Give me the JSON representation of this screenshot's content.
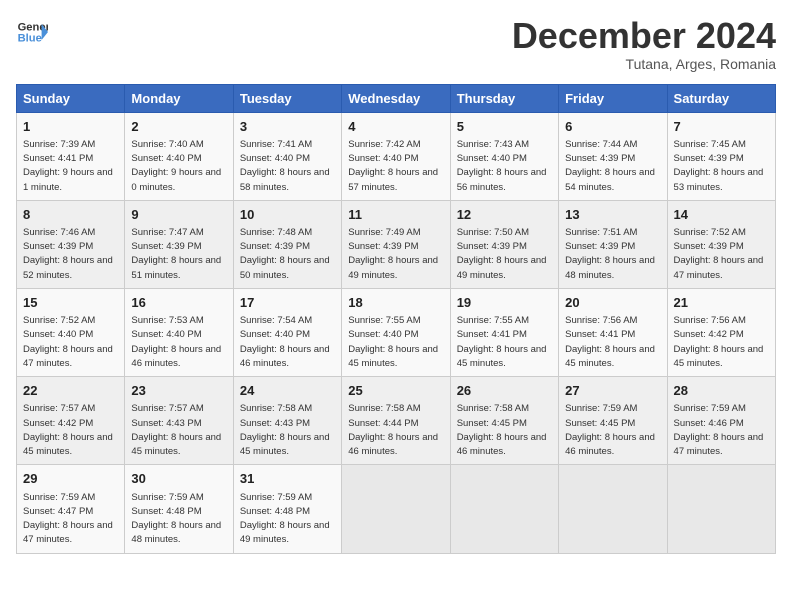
{
  "header": {
    "logo_line1": "General",
    "logo_line2": "Blue",
    "month": "December 2024",
    "location": "Tutana, Arges, Romania"
  },
  "weekdays": [
    "Sunday",
    "Monday",
    "Tuesday",
    "Wednesday",
    "Thursday",
    "Friday",
    "Saturday"
  ],
  "weeks": [
    [
      {
        "day": "1",
        "rise": "Sunrise: 7:39 AM",
        "set": "Sunset: 4:41 PM",
        "daylight": "Daylight: 9 hours and 1 minute."
      },
      {
        "day": "2",
        "rise": "Sunrise: 7:40 AM",
        "set": "Sunset: 4:40 PM",
        "daylight": "Daylight: 9 hours and 0 minutes."
      },
      {
        "day": "3",
        "rise": "Sunrise: 7:41 AM",
        "set": "Sunset: 4:40 PM",
        "daylight": "Daylight: 8 hours and 58 minutes."
      },
      {
        "day": "4",
        "rise": "Sunrise: 7:42 AM",
        "set": "Sunset: 4:40 PM",
        "daylight": "Daylight: 8 hours and 57 minutes."
      },
      {
        "day": "5",
        "rise": "Sunrise: 7:43 AM",
        "set": "Sunset: 4:40 PM",
        "daylight": "Daylight: 8 hours and 56 minutes."
      },
      {
        "day": "6",
        "rise": "Sunrise: 7:44 AM",
        "set": "Sunset: 4:39 PM",
        "daylight": "Daylight: 8 hours and 54 minutes."
      },
      {
        "day": "7",
        "rise": "Sunrise: 7:45 AM",
        "set": "Sunset: 4:39 PM",
        "daylight": "Daylight: 8 hours and 53 minutes."
      }
    ],
    [
      {
        "day": "8",
        "rise": "Sunrise: 7:46 AM",
        "set": "Sunset: 4:39 PM",
        "daylight": "Daylight: 8 hours and 52 minutes."
      },
      {
        "day": "9",
        "rise": "Sunrise: 7:47 AM",
        "set": "Sunset: 4:39 PM",
        "daylight": "Daylight: 8 hours and 51 minutes."
      },
      {
        "day": "10",
        "rise": "Sunrise: 7:48 AM",
        "set": "Sunset: 4:39 PM",
        "daylight": "Daylight: 8 hours and 50 minutes."
      },
      {
        "day": "11",
        "rise": "Sunrise: 7:49 AM",
        "set": "Sunset: 4:39 PM",
        "daylight": "Daylight: 8 hours and 49 minutes."
      },
      {
        "day": "12",
        "rise": "Sunrise: 7:50 AM",
        "set": "Sunset: 4:39 PM",
        "daylight": "Daylight: 8 hours and 49 minutes."
      },
      {
        "day": "13",
        "rise": "Sunrise: 7:51 AM",
        "set": "Sunset: 4:39 PM",
        "daylight": "Daylight: 8 hours and 48 minutes."
      },
      {
        "day": "14",
        "rise": "Sunrise: 7:52 AM",
        "set": "Sunset: 4:39 PM",
        "daylight": "Daylight: 8 hours and 47 minutes."
      }
    ],
    [
      {
        "day": "15",
        "rise": "Sunrise: 7:52 AM",
        "set": "Sunset: 4:40 PM",
        "daylight": "Daylight: 8 hours and 47 minutes."
      },
      {
        "day": "16",
        "rise": "Sunrise: 7:53 AM",
        "set": "Sunset: 4:40 PM",
        "daylight": "Daylight: 8 hours and 46 minutes."
      },
      {
        "day": "17",
        "rise": "Sunrise: 7:54 AM",
        "set": "Sunset: 4:40 PM",
        "daylight": "Daylight: 8 hours and 46 minutes."
      },
      {
        "day": "18",
        "rise": "Sunrise: 7:55 AM",
        "set": "Sunset: 4:40 PM",
        "daylight": "Daylight: 8 hours and 45 minutes."
      },
      {
        "day": "19",
        "rise": "Sunrise: 7:55 AM",
        "set": "Sunset: 4:41 PM",
        "daylight": "Daylight: 8 hours and 45 minutes."
      },
      {
        "day": "20",
        "rise": "Sunrise: 7:56 AM",
        "set": "Sunset: 4:41 PM",
        "daylight": "Daylight: 8 hours and 45 minutes."
      },
      {
        "day": "21",
        "rise": "Sunrise: 7:56 AM",
        "set": "Sunset: 4:42 PM",
        "daylight": "Daylight: 8 hours and 45 minutes."
      }
    ],
    [
      {
        "day": "22",
        "rise": "Sunrise: 7:57 AM",
        "set": "Sunset: 4:42 PM",
        "daylight": "Daylight: 8 hours and 45 minutes."
      },
      {
        "day": "23",
        "rise": "Sunrise: 7:57 AM",
        "set": "Sunset: 4:43 PM",
        "daylight": "Daylight: 8 hours and 45 minutes."
      },
      {
        "day": "24",
        "rise": "Sunrise: 7:58 AM",
        "set": "Sunset: 4:43 PM",
        "daylight": "Daylight: 8 hours and 45 minutes."
      },
      {
        "day": "25",
        "rise": "Sunrise: 7:58 AM",
        "set": "Sunset: 4:44 PM",
        "daylight": "Daylight: 8 hours and 46 minutes."
      },
      {
        "day": "26",
        "rise": "Sunrise: 7:58 AM",
        "set": "Sunset: 4:45 PM",
        "daylight": "Daylight: 8 hours and 46 minutes."
      },
      {
        "day": "27",
        "rise": "Sunrise: 7:59 AM",
        "set": "Sunset: 4:45 PM",
        "daylight": "Daylight: 8 hours and 46 minutes."
      },
      {
        "day": "28",
        "rise": "Sunrise: 7:59 AM",
        "set": "Sunset: 4:46 PM",
        "daylight": "Daylight: 8 hours and 47 minutes."
      }
    ],
    [
      {
        "day": "29",
        "rise": "Sunrise: 7:59 AM",
        "set": "Sunset: 4:47 PM",
        "daylight": "Daylight: 8 hours and 47 minutes."
      },
      {
        "day": "30",
        "rise": "Sunrise: 7:59 AM",
        "set": "Sunset: 4:48 PM",
        "daylight": "Daylight: 8 hours and 48 minutes."
      },
      {
        "day": "31",
        "rise": "Sunrise: 7:59 AM",
        "set": "Sunset: 4:48 PM",
        "daylight": "Daylight: 8 hours and 49 minutes."
      },
      null,
      null,
      null,
      null
    ]
  ]
}
